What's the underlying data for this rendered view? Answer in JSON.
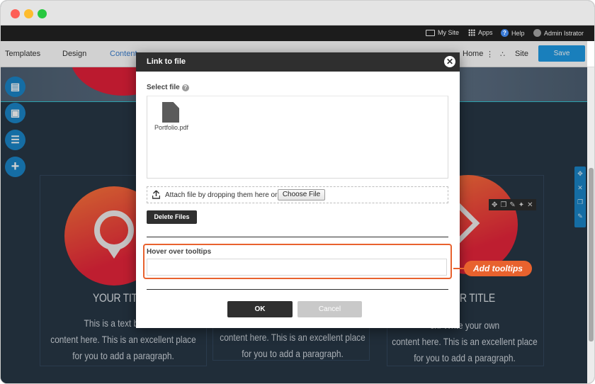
{
  "admin_bar": {
    "my_site": "My Site",
    "apps": "Apps",
    "help": "Help",
    "user": "Admin Istrator"
  },
  "toolbar": {
    "templates": "Templates",
    "design": "Design",
    "content": "Content",
    "home": "Home",
    "site": "Site",
    "save": "Save"
  },
  "page": {
    "card_title_left": "YOUR TITL",
    "card_title_right": "R TITLE",
    "card_text_left": [
      "This is a text box. Wr",
      "content here. This is an excellent place",
      "for you to add a paragraph."
    ],
    "card_text_middle": [
      "content here. This is an excellent place",
      "for you to add a paragraph."
    ],
    "card_text_right": [
      "ox. Write your own",
      "content here. This is an excellent place",
      "for you to add a paragraph."
    ]
  },
  "dialog": {
    "title": "Link to file",
    "select_file_label": "Select file",
    "files": [
      {
        "name": "Portfolio.pdf"
      }
    ],
    "drop_text": "Attach file by dropping them here or",
    "choose_file": "Choose File",
    "delete_files": "Delete Files",
    "hover_label": "Hover over tooltips",
    "hover_value": "",
    "ok": "OK",
    "cancel": "Cancel"
  },
  "callout": {
    "label": "Add tooltips"
  },
  "colors": {
    "accent": "#1f9be6",
    "highlight": "#e8622e",
    "dark": "#2f2f2f"
  }
}
